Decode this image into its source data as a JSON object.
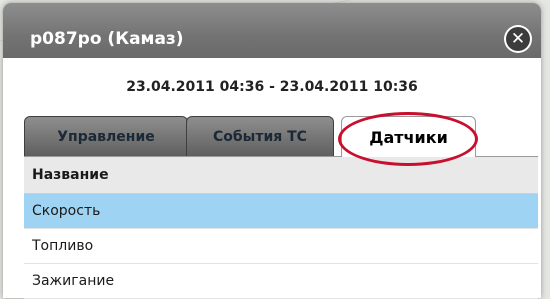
{
  "dialog": {
    "title": "р087ро (Камаз)",
    "date_range": "23.04.2011 04:36 - 23.04.2011 10:36",
    "close_icon": "close-icon"
  },
  "tabs": [
    {
      "label": "Управление",
      "active": false
    },
    {
      "label": "События ТС",
      "active": false
    },
    {
      "label": "Датчики",
      "active": true
    }
  ],
  "sensors": {
    "header": "Название",
    "rows": [
      {
        "name": "Скорость",
        "selected": true
      },
      {
        "name": "Топливо",
        "selected": false
      },
      {
        "name": "Зажигание",
        "selected": false
      }
    ]
  },
  "colors": {
    "highlight_ring": "#c8102e",
    "selected_row": "#9fd3f3"
  }
}
